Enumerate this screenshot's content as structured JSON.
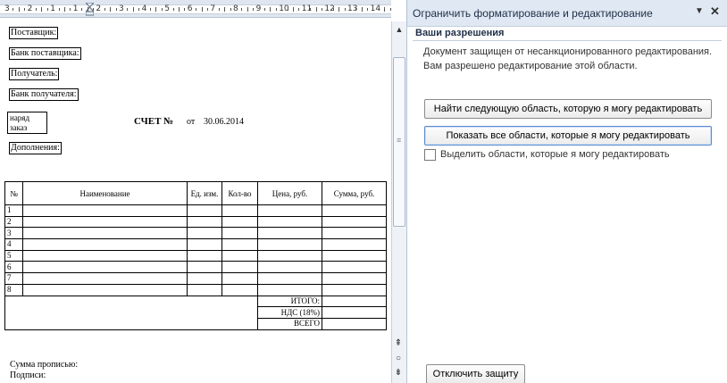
{
  "ruler": {
    "numbers": [
      "3",
      "2",
      "1",
      "1",
      "2",
      "3",
      "4",
      "5",
      "6",
      "7",
      "8",
      "9",
      "10",
      "11",
      "12",
      "13",
      "14",
      "15"
    ],
    "toggle_icon": "ruler-view-icon"
  },
  "document": {
    "supplier_label": "Поставщик:",
    "supplier_bank_label": "Банк поставщика:",
    "recipient_label": "Получатель:",
    "recipient_bank_label": "Банк получателя:",
    "order_line1": "наряд",
    "order_line2": "заказ",
    "invoice_title": "СЧЕТ №",
    "invoice_from": "от",
    "invoice_date": "30.06.2014",
    "additions_label": "Дополнения:",
    "table": {
      "headers": [
        "№",
        "Наименование",
        "Ед. изм.",
        "Кол-во",
        "Цена, руб.",
        "Сумма, руб."
      ],
      "row_numbers": [
        "1",
        "2",
        "3",
        "4",
        "5",
        "6",
        "7",
        "8"
      ],
      "total_label": "ИТОГО:",
      "vat_label": "НДС (18%)",
      "grand_total_label": "ВСЕГО"
    },
    "sum_in_words_label": "Сумма прописью:",
    "signatures_label": "Подписи:"
  },
  "pane": {
    "title": "Ограничить форматирование и редактирование",
    "dropdown_icon": "chevron-down-icon",
    "close_icon": "close-icon",
    "section_title": "Ваши разрешения",
    "message_line1": "Документ защищен от несанкционированного редактирования.",
    "message_line2": "Вам разрешено редактирование этой области.",
    "find_next_button": "Найти следующую область, которую я могу редактировать",
    "show_all_button": "Показать все области, которые я могу редактировать",
    "highlight_label": "Выделить области, которые я могу редактировать",
    "highlight_checked": false,
    "disable_protection_button": "Отключить защиту"
  }
}
